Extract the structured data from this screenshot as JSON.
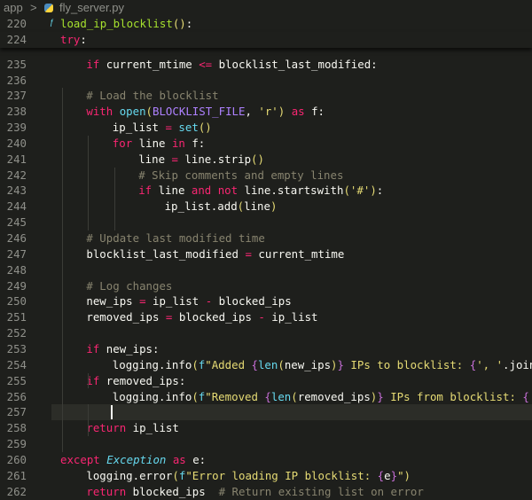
{
  "breadcrumb": {
    "folder": "app",
    "separator": ">",
    "file": "fly_server.py",
    "file_icon": "python-icon"
  },
  "sticky": [
    {
      "num": "220",
      "tokens": [
        [
          "fn",
          "load_ip_blocklist"
        ],
        [
          "par",
          "()"
        ],
        [
          "pl",
          ":"
        ]
      ]
    },
    {
      "num": "224",
      "tokens": [
        [
          "kw",
          "try"
        ],
        [
          "pl",
          ":"
        ]
      ]
    }
  ],
  "lines": [
    {
      "num": "235",
      "indent": 1,
      "tokens": [
        [
          "kw",
          "if"
        ],
        [
          "pl",
          " current_mtime "
        ],
        [
          "kw",
          "<="
        ],
        [
          "pl",
          " blocklist_last_modified:"
        ]
      ]
    },
    {
      "num": "236",
      "indent": 0,
      "tokens": []
    },
    {
      "num": "237",
      "indent": 1,
      "tokens": [
        [
          "cm",
          "# Load the blocklist"
        ]
      ]
    },
    {
      "num": "238",
      "indent": 1,
      "tokens": [
        [
          "kw",
          "with"
        ],
        [
          "pl",
          " "
        ],
        [
          "bi",
          "open"
        ],
        [
          "par",
          "("
        ],
        [
          "cst",
          "BLOCKLIST_FILE"
        ],
        [
          "pl",
          ", "
        ],
        [
          "str",
          "'r'"
        ],
        [
          "par",
          ")"
        ],
        [
          "pl",
          " "
        ],
        [
          "kw",
          "as"
        ],
        [
          "pl",
          " f:"
        ]
      ]
    },
    {
      "num": "239",
      "indent": 2,
      "tokens": [
        [
          "pl",
          "ip_list "
        ],
        [
          "kw",
          "="
        ],
        [
          "pl",
          " "
        ],
        [
          "bi",
          "set"
        ],
        [
          "par",
          "()"
        ]
      ]
    },
    {
      "num": "240",
      "indent": 2,
      "tokens": [
        [
          "kw",
          "for"
        ],
        [
          "pl",
          " line "
        ],
        [
          "kw",
          "in"
        ],
        [
          "pl",
          " f:"
        ]
      ]
    },
    {
      "num": "241",
      "indent": 3,
      "tokens": [
        [
          "pl",
          "line "
        ],
        [
          "kw",
          "="
        ],
        [
          "pl",
          " line.strip"
        ],
        [
          "par",
          "()"
        ]
      ]
    },
    {
      "num": "242",
      "indent": 3,
      "tokens": [
        [
          "cm",
          "# Skip comments and empty lines"
        ]
      ]
    },
    {
      "num": "243",
      "indent": 3,
      "tokens": [
        [
          "kw",
          "if"
        ],
        [
          "pl",
          " line "
        ],
        [
          "kw",
          "and not"
        ],
        [
          "pl",
          " line.startswith"
        ],
        [
          "par",
          "("
        ],
        [
          "str",
          "'#'"
        ],
        [
          "par",
          ")"
        ],
        [
          "pl",
          ":"
        ]
      ]
    },
    {
      "num": "244",
      "indent": 4,
      "tokens": [
        [
          "pl",
          "ip_list.add"
        ],
        [
          "par",
          "("
        ],
        [
          "pl",
          "line"
        ],
        [
          "par",
          ")"
        ]
      ]
    },
    {
      "num": "245",
      "indent": 0,
      "tokens": []
    },
    {
      "num": "246",
      "indent": 1,
      "tokens": [
        [
          "cm",
          "# Update last modified time"
        ]
      ]
    },
    {
      "num": "247",
      "indent": 1,
      "tokens": [
        [
          "pl",
          "blocklist_last_modified "
        ],
        [
          "kw",
          "="
        ],
        [
          "pl",
          " current_mtime"
        ]
      ]
    },
    {
      "num": "248",
      "indent": 0,
      "tokens": []
    },
    {
      "num": "249",
      "indent": 1,
      "tokens": [
        [
          "cm",
          "# Log changes"
        ]
      ]
    },
    {
      "num": "250",
      "indent": 1,
      "tokens": [
        [
          "pl",
          "new_ips "
        ],
        [
          "kw",
          "="
        ],
        [
          "pl",
          " ip_list "
        ],
        [
          "kw",
          "-"
        ],
        [
          "pl",
          " blocked_ips"
        ]
      ]
    },
    {
      "num": "251",
      "indent": 1,
      "tokens": [
        [
          "pl",
          "removed_ips "
        ],
        [
          "kw",
          "="
        ],
        [
          "pl",
          " blocked_ips "
        ],
        [
          "kw",
          "-"
        ],
        [
          "pl",
          " ip_list"
        ]
      ]
    },
    {
      "num": "252",
      "indent": 0,
      "tokens": []
    },
    {
      "num": "253",
      "indent": 1,
      "tokens": [
        [
          "kw",
          "if"
        ],
        [
          "pl",
          " new_ips:"
        ]
      ]
    },
    {
      "num": "254",
      "indent": 2,
      "tokens": [
        [
          "pl",
          "logging.info"
        ],
        [
          "par",
          "("
        ],
        [
          "bi",
          "f"
        ],
        [
          "str",
          "\"Added "
        ],
        [
          "brc",
          "{"
        ],
        [
          "bi",
          "len"
        ],
        [
          "par",
          "("
        ],
        [
          "pl",
          "new_ips"
        ],
        [
          "par",
          ")"
        ],
        [
          "brc",
          "}"
        ],
        [
          "str",
          " IPs to blocklist: "
        ],
        [
          "brc",
          "{"
        ],
        [
          "str",
          "', '"
        ],
        [
          "pl",
          ".join"
        ],
        [
          "par",
          "("
        ]
      ]
    },
    {
      "num": "255",
      "indent": 1,
      "tokens": [
        [
          "kw",
          "if"
        ],
        [
          "pl",
          " removed_ips:"
        ]
      ]
    },
    {
      "num": "256",
      "indent": 2,
      "tokens": [
        [
          "pl",
          "logging.info"
        ],
        [
          "par",
          "("
        ],
        [
          "bi",
          "f"
        ],
        [
          "str",
          "\"Removed "
        ],
        [
          "brc",
          "{"
        ],
        [
          "bi",
          "len"
        ],
        [
          "par",
          "("
        ],
        [
          "pl",
          "removed_ips"
        ],
        [
          "par",
          ")"
        ],
        [
          "brc",
          "}"
        ],
        [
          "str",
          " IPs from blocklist: "
        ],
        [
          "brc",
          "{"
        ],
        [
          "str",
          "',"
        ]
      ]
    },
    {
      "num": "257",
      "indent": 0,
      "tokens": [],
      "current": true
    },
    {
      "num": "258",
      "indent": 1,
      "tokens": [
        [
          "kw",
          "return"
        ],
        [
          "pl",
          " ip_list"
        ]
      ]
    },
    {
      "num": "259",
      "indent": 0,
      "tokens": []
    },
    {
      "num": "260",
      "indent": 0,
      "tokens": [
        [
          "kw",
          "except"
        ],
        [
          "pl",
          " "
        ],
        [
          "cls",
          "Exception"
        ],
        [
          "pl",
          " "
        ],
        [
          "kw",
          "as"
        ],
        [
          "pl",
          " e:"
        ]
      ]
    },
    {
      "num": "261",
      "indent": 1,
      "tokens": [
        [
          "pl",
          "logging.error"
        ],
        [
          "par",
          "("
        ],
        [
          "bi",
          "f"
        ],
        [
          "str",
          "\"Error loading IP blocklist: "
        ],
        [
          "brc",
          "{"
        ],
        [
          "pl",
          "e"
        ],
        [
          "brc",
          "}"
        ],
        [
          "str",
          "\""
        ],
        [
          "par",
          ")"
        ]
      ]
    },
    {
      "num": "262",
      "indent": 1,
      "tokens": [
        [
          "kw",
          "return"
        ],
        [
          "pl",
          " blocked_ips  "
        ],
        [
          "cm",
          "# Return existing list on error"
        ]
      ]
    }
  ]
}
